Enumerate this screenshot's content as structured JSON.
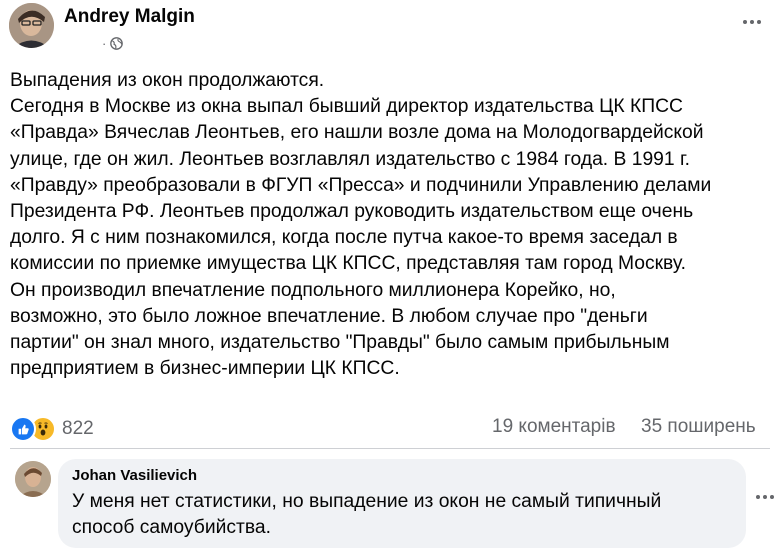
{
  "post": {
    "author": "Andrey Malgin",
    "meta_separator": "·",
    "privacy_icon": "globe-icon",
    "more_icon": "more-options-icon",
    "text_lines": [
      "Выпадения из окон продолжаются.",
      "Сегодня в Москве из окна выпал бывший директор издательства ЦК КПСС",
      "«Правда» Вячеслав Леонтьев, его нашли возле дома на Молодогвардейской",
      "улице, где он жил. Леонтьев возглавлял издательство с 1984 года. В 1991 г.",
      "«Правду» преобразовали в ФГУП «Пресса» и подчинили Управлению делами",
      "Президента РФ. Леонтьев продолжал руководить издательством еще очень",
      "долго. Я с ним познакомился, когда после путча какое-то время заседал в",
      "комиссии по приемке имущества ЦК КПСС, представляя там город Москву.",
      "Он производил впечатление подпольного миллионера Корейко, но,",
      "возможно, это было ложное впечатление. В любом случае про \"деньги",
      "партии\" он знал много, издательство \"Правды\" было самым прибыльным",
      "предприятием в бизнес-империи ЦК КПСС."
    ]
  },
  "stats": {
    "reaction_icons": [
      "like-icon",
      "wow-icon"
    ],
    "reactions_count": "822",
    "comments_count": "19 коментарів",
    "shares_count": "35 поширень"
  },
  "comment": {
    "author": "Johan Vasilievich",
    "text_lines": [
      "У меня нет статистики, но выпадение из окон не самый типичный",
      "способ самоубийства."
    ]
  },
  "colors": {
    "text": "#050505",
    "secondary_text": "#65676b",
    "like_blue": "#1877f2",
    "wow_yellow": "#f7b928",
    "comment_bg": "#f0f2f5",
    "divider": "#ced0d4"
  }
}
